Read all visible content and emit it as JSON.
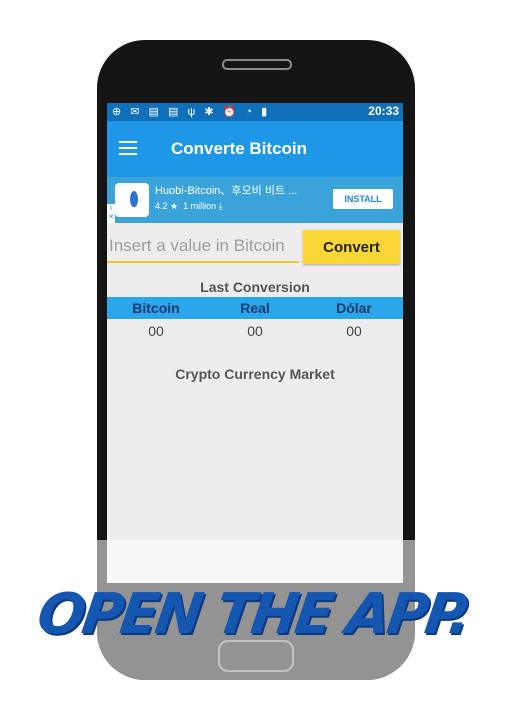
{
  "status_bar": {
    "time": "20:33"
  },
  "app_bar": {
    "title": "Converte Bitcoin",
    "menu_icon": "hamburger-menu-icon"
  },
  "ad": {
    "title": "Huobi-Bitcoin、후오비 비트 ...",
    "rating": "4.2",
    "downloads": "1 million",
    "button": "INSTALL"
  },
  "converter": {
    "input_placeholder": "Insert a value in Bitcoin",
    "convert_label": "Convert"
  },
  "last_conversion": {
    "title": "Last Conversion",
    "headers": [
      "Bitcoin",
      "Real",
      "Dólar"
    ],
    "values": [
      "00",
      "00",
      "00"
    ]
  },
  "market": {
    "title": "Crypto Currency Market"
  },
  "banner": {
    "text": "OPEN THE APP."
  },
  "colors": {
    "app_bar": "#1e98e6",
    "table_header": "#2aa7ea",
    "convert_button": "#fbd637",
    "banner": "#1456b0"
  }
}
